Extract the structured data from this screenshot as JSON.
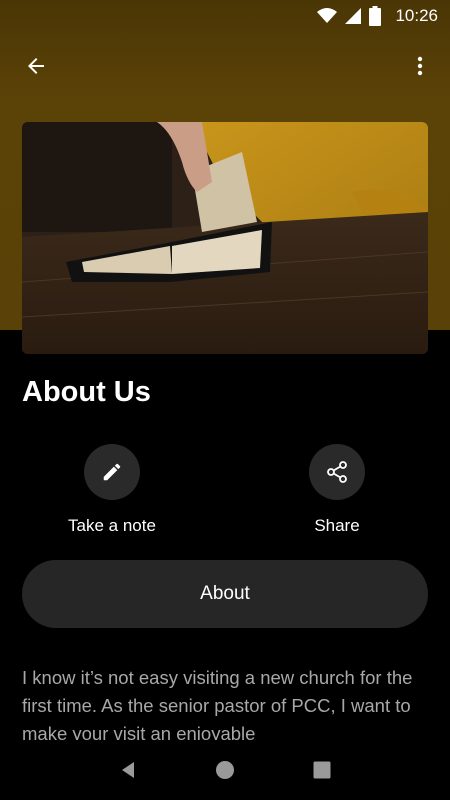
{
  "status_bar": {
    "time": "10:26",
    "icons": [
      "wifi-icon",
      "cell-signal-icon",
      "battery-icon"
    ]
  },
  "toolbar": {
    "back_icon": "arrow-left-icon",
    "menu_icon": "more-vert-icon"
  },
  "hero": {
    "image": "open-bible-on-wooden-table-photo"
  },
  "page": {
    "title": "About Us"
  },
  "actions": [
    {
      "label": "Take a note",
      "icon": "pencil-icon"
    },
    {
      "label": "Share",
      "icon": "share-icon"
    }
  ],
  "about_button": {
    "label": "About"
  },
  "body": {
    "text": "I know it’s not easy visiting a new church for the first time. As the senior pastor of PCC, I want to make your visit an enjoyable"
  },
  "nav_bar": {
    "icons": [
      "back-triangle-icon",
      "home-circle-icon",
      "recents-square-icon"
    ]
  },
  "colors": {
    "header": "#5a4107",
    "background": "#000000",
    "button": "#262626",
    "body_text": "#a8a8a8"
  }
}
